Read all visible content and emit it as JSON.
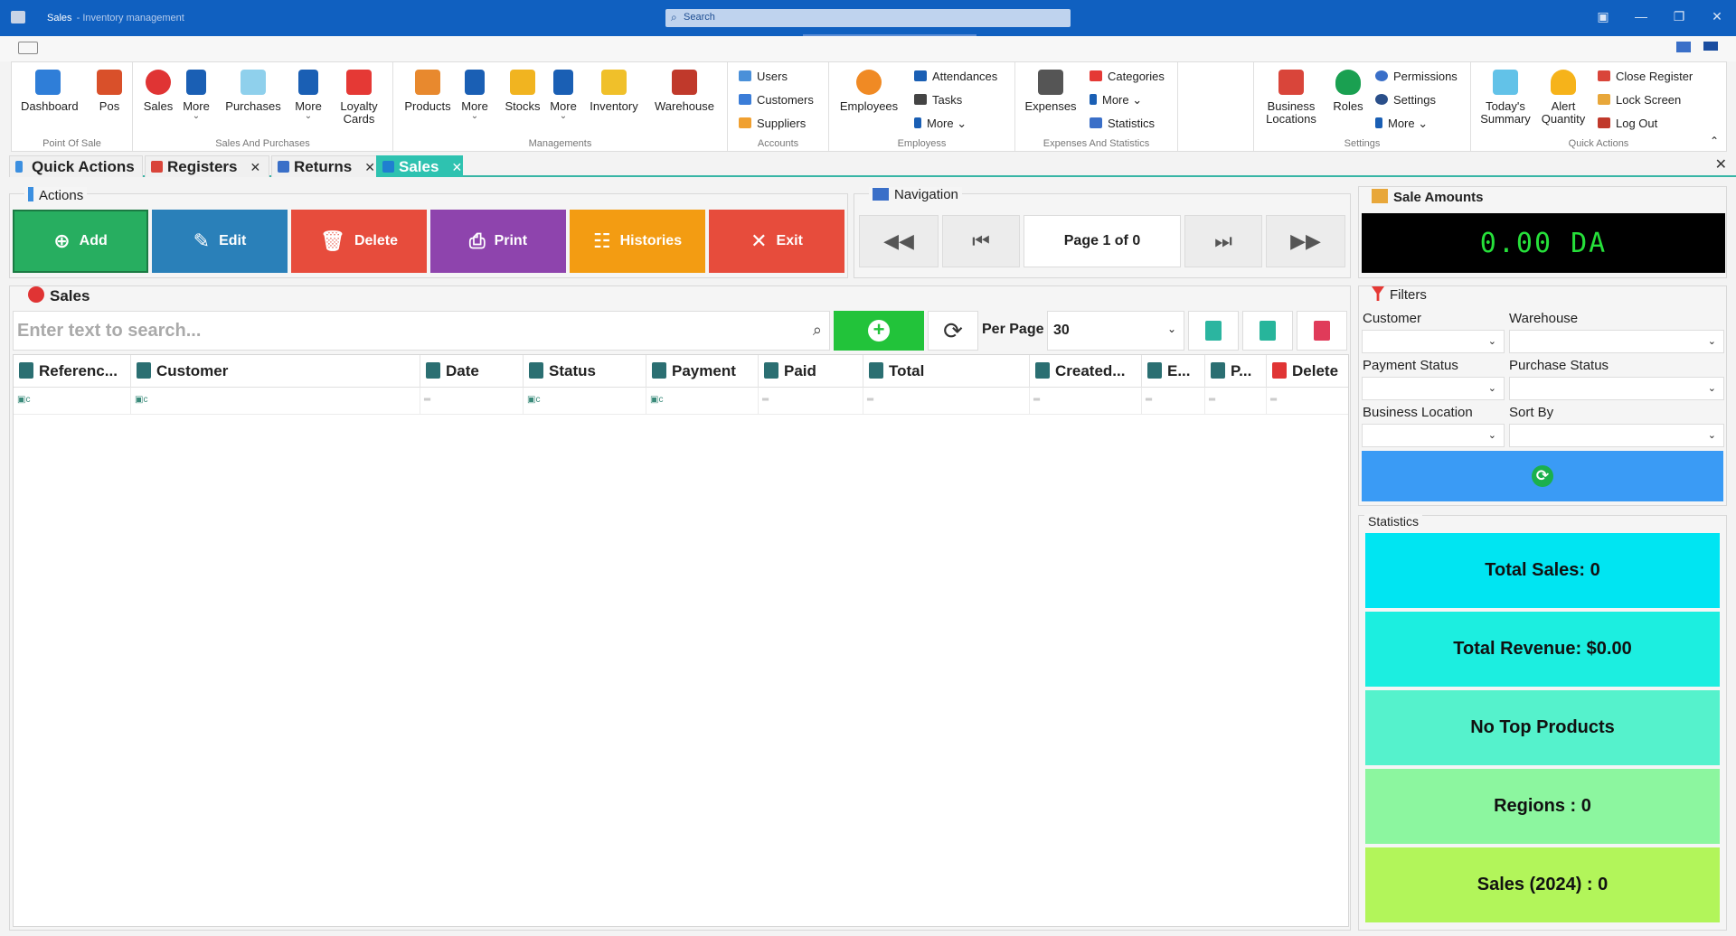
{
  "window": {
    "title": "Sales",
    "subtitle": "- Inventory management",
    "search_placeholder": "Search"
  },
  "ribbon": {
    "groups": [
      {
        "label": "Point Of Sale"
      },
      {
        "label": "Sales And Purchases"
      },
      {
        "label": "Managements"
      },
      {
        "label": "Accounts"
      },
      {
        "label": "Employess"
      },
      {
        "label": "Expenses And Statistics"
      },
      {
        "label": "Settings"
      },
      {
        "label": "Quick Actions"
      }
    ],
    "buttons": {
      "dashboard": "Dashboard",
      "pos": "Pos",
      "sales": "Sales",
      "more1": "More",
      "purchases": "Purchases",
      "more2": "More",
      "loyalty": "Loyalty Cards",
      "products": "Products",
      "more3": "More",
      "stocks": "Stocks",
      "more4": "More",
      "inventory": "Inventory",
      "warehouse": "Warehouse",
      "users": "Users",
      "customers": "Customers",
      "suppliers": "Suppliers",
      "employees": "Employees",
      "attendances": "Attendances",
      "tasks": "Tasks",
      "more5": "More",
      "expenses": "Expenses",
      "categories": "Categories",
      "more6": "More",
      "statistics": "Statistics",
      "business_locations": "Business Locations",
      "roles": "Roles",
      "permissions": "Permissions",
      "settings": "Settings",
      "more7": "More",
      "todays_summary": "Today's Summary",
      "alert_quantity": "Alert Quantity",
      "close_register": "Close Register",
      "lock_screen": "Lock Screen",
      "log_out": "Log Out"
    },
    "icons": {
      "dashboard": "dashboard-icon",
      "pos": "pos-icon",
      "sales": "sale-badge-icon",
      "purchases": "purchases-icon",
      "loyalty": "percent-icon",
      "products": "box-icon",
      "stocks": "cart-icon",
      "inventory": "inventory-icon",
      "warehouse": "warehouse-icon",
      "employees": "employee-icon",
      "expenses": "money-bag-icon",
      "business_locations": "store-icon",
      "roles": "shield-check-icon",
      "todays_summary": "summary-icon",
      "alert_quantity": "bell-icon"
    }
  },
  "tabs": [
    {
      "label": "Quick Actions",
      "icon": "lightning-icon",
      "closable": false
    },
    {
      "label": "Registers",
      "icon": "register-icon",
      "closable": true
    },
    {
      "label": "Returns",
      "icon": "returns-icon",
      "closable": true
    },
    {
      "label": "Sales",
      "icon": "sales-icon",
      "closable": true,
      "active": true
    }
  ],
  "actions": {
    "title": "Actions",
    "buttons": [
      {
        "label": "Add",
        "color": "#27ae60",
        "icon": "plus-circle-icon"
      },
      {
        "label": "Edit",
        "color": "#2a80b9",
        "icon": "edit-icon"
      },
      {
        "label": "Delete",
        "color": "#e74c3c",
        "icon": "trash-icon"
      },
      {
        "label": "Print",
        "color": "#8e44ad",
        "icon": "printer-icon"
      },
      {
        "label": "Histories",
        "color": "#f39c12",
        "icon": "history-icon"
      },
      {
        "label": "Exit",
        "color": "#e74c3c",
        "icon": "close-icon"
      }
    ]
  },
  "navigation": {
    "title": "Navigation",
    "page_label": "Page 1 of 0"
  },
  "sale_amounts": {
    "title": "Sale Amounts",
    "value": "0.00 DA",
    "value_color": "#26e03a"
  },
  "sales": {
    "title": "Sales",
    "search_placeholder": "Enter text to search...",
    "per_page_label": "Per Page",
    "per_page_value": "30",
    "columns": [
      "Referenc...",
      "Customer",
      "Date",
      "Status",
      "Payment",
      "Paid",
      "Total",
      "Created...",
      "E...",
      "P...",
      "Delete"
    ]
  },
  "filters": {
    "title": "Filters",
    "labels": {
      "customer": "Customer",
      "warehouse": "Warehouse",
      "payment_status": "Payment Status",
      "purchase_status": "Purchase Status",
      "business_location": "Business Location",
      "sort_by": "Sort By"
    }
  },
  "statistics": {
    "title": "Statistics",
    "cards": [
      {
        "label": "Total Sales: 0",
        "color": "#00e5f2"
      },
      {
        "label": "Total Revenue: $0.00",
        "color": "#1ceee0"
      },
      {
        "label": "No Top Products",
        "color": "#55f2cc"
      },
      {
        "label": "Regions : 0",
        "color": "#8cf69f"
      },
      {
        "label": "Sales (2024) : 0",
        "color": "#b2f55a"
      }
    ]
  }
}
